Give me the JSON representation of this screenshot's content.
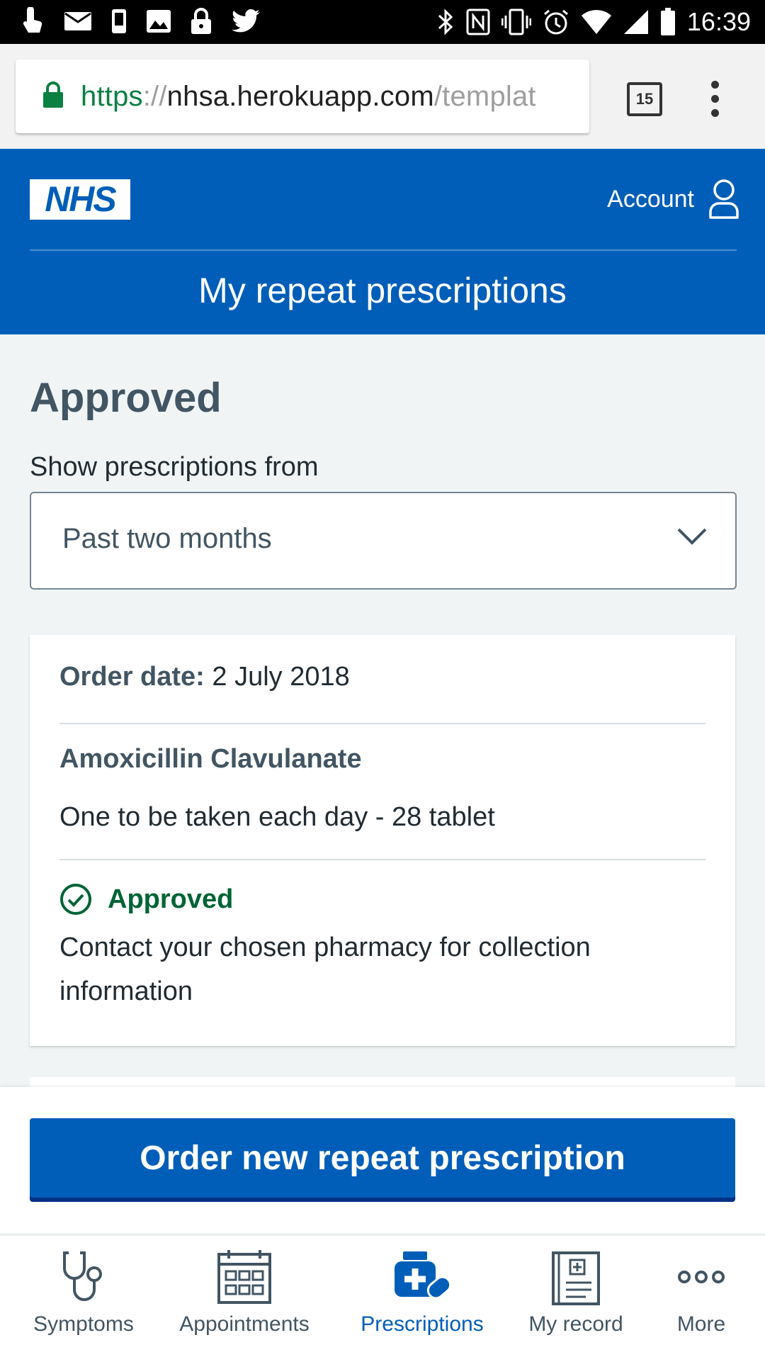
{
  "status_bar": {
    "time": "16:39"
  },
  "browser": {
    "url_scheme": "https",
    "url_separator": "://",
    "url_host": "nhsa.herokuapp.com",
    "url_path": "/templat",
    "tab_count": "15"
  },
  "header": {
    "logo_text": "NHS",
    "account_label": "Account",
    "title": "My repeat prescriptions"
  },
  "main": {
    "section_heading": "Approved",
    "filter_label": "Show prescriptions from",
    "filter_value": "Past two months"
  },
  "prescription": {
    "order_date_label": "Order date:",
    "order_date_value": " 2 July 2018",
    "medication_name": "Amoxicillin Clavulanate",
    "medication_dosage": "One to be taken each day - 28 tablet",
    "status_label": "Approved",
    "status_info": "Contact your chosen pharmacy for collection information"
  },
  "actions": {
    "order_button": "Order new repeat prescription"
  },
  "tab_bar": {
    "items": [
      {
        "label": "Symptoms",
        "icon": "stethoscope-icon"
      },
      {
        "label": "Appointments",
        "icon": "calendar-icon"
      },
      {
        "label": "Prescriptions",
        "icon": "prescription-bottle-icon",
        "active": true
      },
      {
        "label": "My record",
        "icon": "medical-record-icon"
      },
      {
        "label": "More",
        "icon": "more-dots-icon"
      }
    ]
  },
  "colors": {
    "nhs_blue": "#005eb8",
    "approved_green": "#006435",
    "heading_grey": "#425563",
    "background": "#f0f4f5"
  }
}
